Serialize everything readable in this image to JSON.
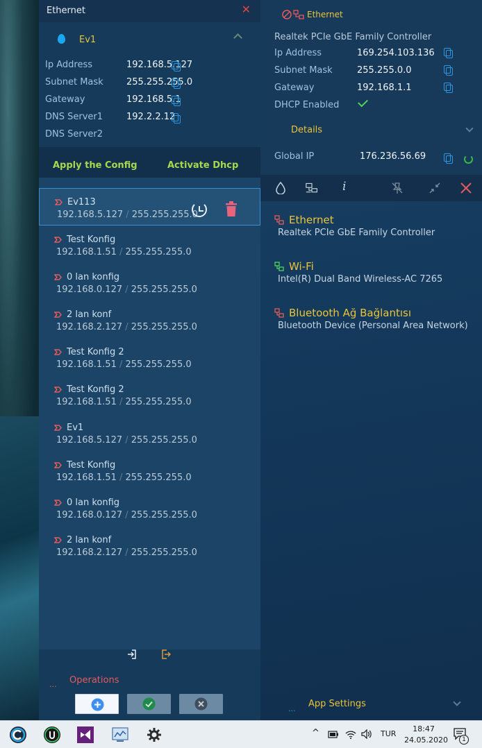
{
  "left_panel": {
    "title": "Ethernet",
    "close_symbol": "✕",
    "active_profile": {
      "name": "Ev1",
      "icon": "drop-icon",
      "fields": [
        {
          "label": "Ip Address",
          "value": "192.168.5.127"
        },
        {
          "label": "Subnet Mask",
          "value": "255.255.255.0"
        },
        {
          "label": "Gateway",
          "value": "192.168.5.1"
        },
        {
          "label": "DNS Server1",
          "value": "192.2.2.12"
        },
        {
          "label": "DNS Server2",
          "value": ""
        }
      ]
    },
    "actions": {
      "apply": "Apply the Config",
      "dhcp": "Activate Dhcp"
    },
    "profiles": [
      {
        "name": "Ev113",
        "ip": "192.168.5.127",
        "mask": "255.255.255.0"
      },
      {
        "name": "Test Konfig",
        "ip": "192.168.1.51",
        "mask": "255.255.255.0"
      },
      {
        "name": "0 lan konfig",
        "ip": "192.168.0.127",
        "mask": "255.255.255.0"
      },
      {
        "name": "2 lan konf",
        "ip": "192.168.2.127",
        "mask": "255.255.255.0"
      },
      {
        "name": "Test Konfig 2",
        "ip": "192.168.1.51",
        "mask": "255.255.255.0"
      },
      {
        "name": "Test Konfig 2",
        "ip": "192.168.1.51",
        "mask": "255.255.255.0"
      },
      {
        "name": "Ev1",
        "ip": "192.168.5.127",
        "mask": "255.255.255.0"
      },
      {
        "name": "Test Konfig",
        "ip": "192.168.1.51",
        "mask": "255.255.255.0"
      },
      {
        "name": "0 lan konfig",
        "ip": "192.168.0.127",
        "mask": "255.255.255.0"
      },
      {
        "name": "2 lan konf",
        "ip": "192.168.2.127",
        "mask": "255.255.255.0"
      }
    ],
    "separator": "/",
    "operations": {
      "dots": "...",
      "label": "Operations"
    }
  },
  "right_panel": {
    "adapter_title": "Ethernet",
    "controller": "Realtek PCIe GbE Family Controller",
    "fields": [
      {
        "label": "Ip Address",
        "value": "169.254.103.136"
      },
      {
        "label": "Subnet Mask",
        "value": "255.255.0.0"
      },
      {
        "label": "Gateway",
        "value": "192.168.1.1"
      },
      {
        "label": "DHCP Enabled",
        "value": ""
      }
    ],
    "details_label": "Details",
    "global_ip_label": "Global IP",
    "global_ip_value": "176.236.56.69",
    "toolbar_icons": [
      "drop-icon",
      "network-icon",
      "info-icon",
      "unpin-icon",
      "collapse-icon",
      "close-icon"
    ],
    "info_glyph": "i",
    "adapters": [
      {
        "name": "Ethernet",
        "device": "Realtek PCIe GbE Family Controller",
        "color": "#e35b5b"
      },
      {
        "name": "Wi-Fi",
        "device": "Intel(R) Dual Band Wireless-AC 7265",
        "color": "#4fd65c"
      },
      {
        "name": "Bluetooth Ağ Bağlantısı",
        "device": "Bluetooth Device (Personal Area Network)",
        "color": "#e35b5b"
      }
    ],
    "app_settings_dots": "...",
    "app_settings": "App Settings"
  },
  "taskbar": {
    "apps": [
      "ccleaner-icon",
      "iobit-icon",
      "visual-studio-icon",
      "network-app-icon",
      "settings-icon"
    ],
    "lang": "TUR",
    "time": "18:47",
    "date": "24.05.2020",
    "notification_count": "1"
  },
  "colors": {
    "accent_yellow": "#eac43a",
    "accent_green": "#a8d84e",
    "accent_red": "#e35b5b",
    "accent_blue": "#2c96e0"
  }
}
